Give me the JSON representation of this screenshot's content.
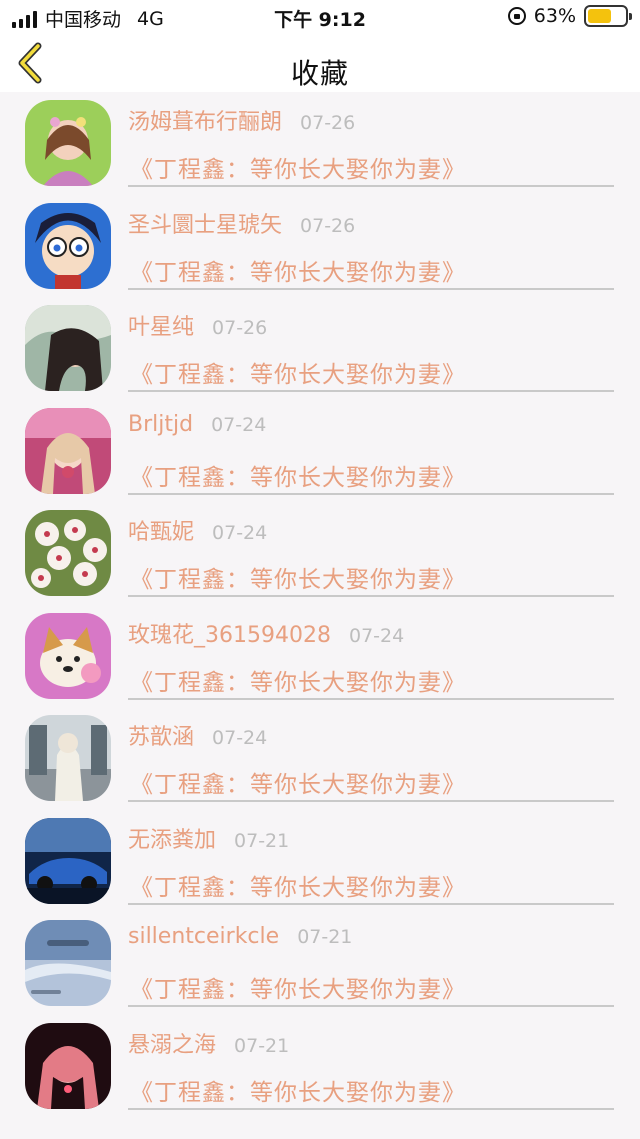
{
  "status_bar": {
    "carrier": "中国移动",
    "network": "4G",
    "time": "下午 9:12",
    "battery_text": "63%",
    "battery_level": 0.63
  },
  "nav": {
    "back_icon": "chevron-left-icon",
    "title": "收藏"
  },
  "colors": {
    "accent": "#e8a080",
    "date": "#bdbdbd",
    "battery": "#f4c20d"
  },
  "favorites": [
    {
      "name": "汤姆葺布行酾朗",
      "date": "07-26",
      "title": "《丁程鑫：等你长大娶你为妻》"
    },
    {
      "name": "圣斗圜士星琥矢",
      "date": "07-26",
      "title": "《丁程鑫：等你长大娶你为妻》"
    },
    {
      "name": "叶星纯",
      "date": "07-26",
      "title": "《丁程鑫：等你长大娶你为妻》"
    },
    {
      "name": "Brljtjd",
      "date": "07-24",
      "title": "《丁程鑫：等你长大娶你为妻》"
    },
    {
      "name": "哈甄妮",
      "date": "07-24",
      "title": "《丁程鑫：等你长大娶你为妻》"
    },
    {
      "name": "玫瑰花_361594028",
      "date": "07-24",
      "title": "《丁程鑫：等你长大娶你为妻》"
    },
    {
      "name": "苏歆涵",
      "date": "07-24",
      "title": "《丁程鑫：等你长大娶你为妻》"
    },
    {
      "name": "无添粪加",
      "date": "07-21",
      "title": "《丁程鑫：等你长大娶你为妻》"
    },
    {
      "name": "sillentceirkcle",
      "date": "07-21",
      "title": "《丁程鑫：等你长大娶你为妻》"
    },
    {
      "name": "悬溺之海",
      "date": "07-21",
      "title": "《丁程鑫：等你长大娶你为妻》"
    }
  ]
}
